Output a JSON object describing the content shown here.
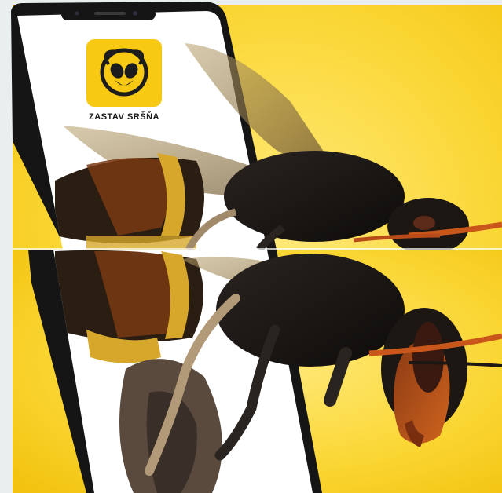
{
  "brand": {
    "logo_label": "ZASTAV SRŠŇA",
    "logo_icon": "hornet-face-icon",
    "accent": "#F7C913",
    "dark": "#1c1c1c"
  },
  "scene": {
    "subject": "hornet-photo",
    "device": "smartphone",
    "background": "#F9CF1D"
  }
}
